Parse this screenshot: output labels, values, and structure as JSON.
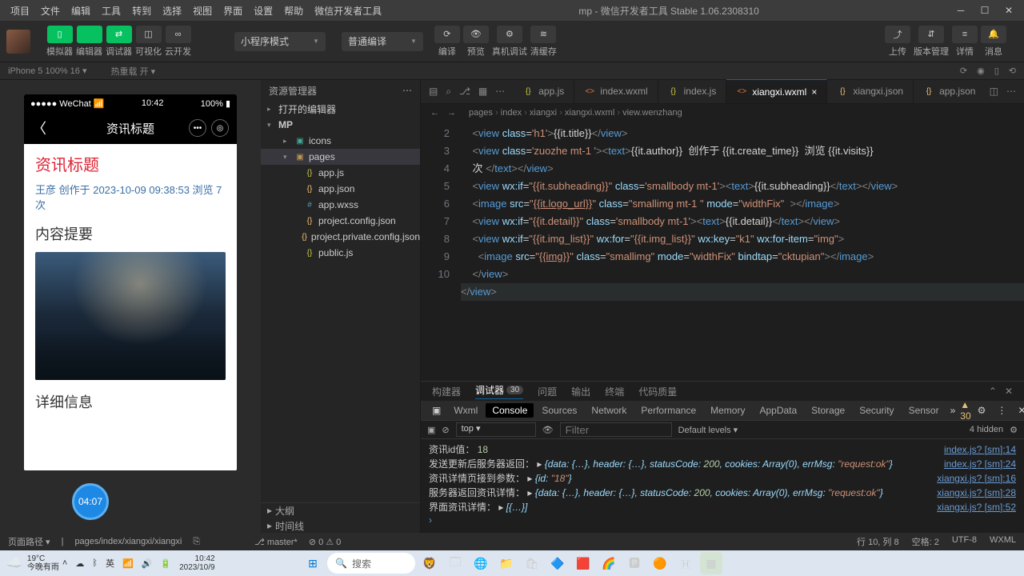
{
  "window": {
    "title": "mp - 微信开发者工具 Stable 1.06.2308310"
  },
  "menubar": [
    "项目",
    "文件",
    "编辑",
    "工具",
    "转到",
    "选择",
    "视图",
    "界面",
    "设置",
    "帮助",
    "微信开发者工具"
  ],
  "toolbar": {
    "modes": [
      {
        "icon": "▯",
        "label": "模拟器",
        "green": true
      },
      {
        "icon": "</>",
        "label": "编辑器",
        "green": true
      },
      {
        "icon": "⇄",
        "label": "调试器",
        "green": true
      },
      {
        "icon": "◫",
        "label": "可视化",
        "green": false
      },
      {
        "icon": "∞",
        "label": "云开发",
        "green": false
      }
    ],
    "dd1": "小程序模式",
    "dd2": "普通编译",
    "mid": [
      {
        "icon": "⟳",
        "label": "编译"
      },
      {
        "icon": "👁",
        "label": "预览"
      },
      {
        "icon": "⚙",
        "label": "真机调试"
      },
      {
        "icon": "≋",
        "label": "清缓存"
      }
    ],
    "right": [
      {
        "icon": "⤴",
        "label": "上传"
      },
      {
        "icon": "⇵",
        "label": "版本管理"
      },
      {
        "icon": "≡",
        "label": "详情"
      },
      {
        "icon": "🔔",
        "label": "消息"
      }
    ]
  },
  "devicebar": {
    "device": "iPhone 5 100% 16 ▾",
    "hot": "热重载 开 ▾"
  },
  "sim": {
    "carrier": "●●●●● WeChat",
    "signal": "📶",
    "time": "10:42",
    "battery": "100% ▮",
    "navTitle": "资讯标题",
    "h1": "资讯标题",
    "meta": "王彦 创作于 2023-10-09 09:38:53 浏览 7 次",
    "sub": "内容提要",
    "detail": "详细信息",
    "rec": "04:07"
  },
  "explorer": {
    "title": "资源管理器",
    "section1": "打开的编辑器",
    "root": "MP",
    "items": [
      {
        "pad": 28,
        "chev": "▸",
        "cls": "folder2",
        "icon": "▣",
        "name": "icons"
      },
      {
        "pad": 28,
        "chev": "▾",
        "cls": "folder",
        "icon": "▣",
        "name": "pages",
        "sel": true
      },
      {
        "pad": 40,
        "chev": "",
        "cls": "js",
        "icon": "{}",
        "name": "app.js"
      },
      {
        "pad": 40,
        "chev": "",
        "cls": "json",
        "icon": "{}",
        "name": "app.json"
      },
      {
        "pad": 40,
        "chev": "",
        "cls": "wxss",
        "icon": "#",
        "name": "app.wxss"
      },
      {
        "pad": 40,
        "chev": "",
        "cls": "json",
        "icon": "{}",
        "name": "project.config.json"
      },
      {
        "pad": 40,
        "chev": "",
        "cls": "json",
        "icon": "{}",
        "name": "project.private.config.json"
      },
      {
        "pad": 40,
        "chev": "",
        "cls": "js",
        "icon": "{}",
        "name": "public.js"
      }
    ],
    "outline": "大纲",
    "timeline": "时间线"
  },
  "tabs": [
    {
      "cls": "js",
      "icon": "{}",
      "name": "app.js"
    },
    {
      "cls": "wxml",
      "icon": "<>",
      "name": "index.wxml"
    },
    {
      "cls": "js",
      "icon": "{}",
      "name": "index.js"
    },
    {
      "cls": "wxml",
      "icon": "<>",
      "name": "xiangxi.wxml",
      "active": true,
      "close": "×"
    },
    {
      "cls": "json",
      "icon": "{}",
      "name": "xiangxi.json"
    },
    {
      "cls": "json",
      "icon": "{}",
      "name": "app.json"
    }
  ],
  "breadcrumb": [
    "pages",
    "index",
    "xiangxi",
    "xiangxi.wxml",
    "view.wenzhang"
  ],
  "code": [
    {
      "n": 2,
      "t": "    <span class='tok-punc'>&lt;</span><span class='tok-tag'>view</span> <span class='tok-attr'>class</span>=<span class='tok-str'>'h1'</span><span class='tok-punc'>&gt;</span><span class='tok-txt'>{{it.title}}</span><span class='tok-punc'>&lt;/</span><span class='tok-tag'>view</span><span class='tok-punc'>&gt;</span>"
    },
    {
      "n": 3,
      "t": "    <span class='tok-punc'>&lt;</span><span class='tok-tag'>view</span> <span class='tok-attr'>class</span>=<span class='tok-str'>'zuozhe mt-1 '</span><span class='tok-punc'>&gt;&lt;</span><span class='tok-tag'>text</span><span class='tok-punc'>&gt;</span><span class='tok-txt'>{{it.author}}  创作于 {{it.create_time}}  浏览 {{it.visits}} </span>"
    },
    {
      "n": "",
      "t": "    <span class='tok-txt'>次 </span><span class='tok-punc'>&lt;/</span><span class='tok-tag'>text</span><span class='tok-punc'>&gt;&lt;/</span><span class='tok-tag'>view</span><span class='tok-punc'>&gt;</span>"
    },
    {
      "n": 4,
      "t": "    <span class='tok-punc'>&lt;</span><span class='tok-tag'>view</span> <span class='tok-attr'>wx:if</span>=<span class='tok-str'>\"{{it.subheading}}\"</span> <span class='tok-attr'>class</span>=<span class='tok-str'>'smallbody mt-1'</span><span class='tok-punc'>&gt;&lt;</span><span class='tok-tag'>text</span><span class='tok-punc'>&gt;</span><span class='tok-txt'>{{it.subheading}}</span><span class='tok-punc'>&lt;/</span><span class='tok-tag'>text</span><span class='tok-punc'>&gt;&lt;/</span><span class='tok-tag'>view</span><span class='tok-punc'>&gt;</span>"
    },
    {
      "n": 5,
      "t": "    <span class='tok-punc'>&lt;</span><span class='tok-tag'>image</span> <span class='tok-attr'>src</span>=<span class='tok-str'>\"<u>{{it.logo_url}}</u>\"</span> <span class='tok-attr'>class</span>=<span class='tok-str'>\"smallimg mt-1 \"</span> <span class='tok-attr'>mode</span>=<span class='tok-str'>\"widthFix\"</span>  <span class='tok-punc'>&gt;&lt;/</span><span class='tok-tag'>image</span><span class='tok-punc'>&gt;</span>"
    },
    {
      "n": 6,
      "t": "    <span class='tok-punc'>&lt;</span><span class='tok-tag'>view</span> <span class='tok-attr'>wx:if</span>=<span class='tok-str'>\"{{it.detail}}\"</span> <span class='tok-attr'>class</span>=<span class='tok-str'>'smallbody mt-1'</span><span class='tok-punc'>&gt;&lt;</span><span class='tok-tag'>text</span><span class='tok-punc'>&gt;</span><span class='tok-txt'>{{it.detail}}</span><span class='tok-punc'>&lt;/</span><span class='tok-tag'>text</span><span class='tok-punc'>&gt;&lt;/</span><span class='tok-tag'>view</span><span class='tok-punc'>&gt;</span>"
    },
    {
      "n": 7,
      "t": "    <span class='tok-punc'>&lt;</span><span class='tok-tag'>view</span> <span class='tok-attr'>wx:if</span>=<span class='tok-str'>\"{{it.img_list}}\"</span> <span class='tok-attr'>wx:for</span>=<span class='tok-str'>\"{{it.img_list}}\"</span> <span class='tok-attr'>wx:key</span>=<span class='tok-str'>\"k1\"</span> <span class='tok-attr'>wx:for-item</span>=<span class='tok-str'>\"img\"</span><span class='tok-punc'>&gt;</span>"
    },
    {
      "n": 8,
      "t": "      <span class='tok-punc'>&lt;</span><span class='tok-tag'>image</span> <span class='tok-attr'>src</span>=<span class='tok-str'>\"<u>{{img}}</u>\"</span> <span class='tok-attr'>class</span>=<span class='tok-str'>\"smallimg\"</span> <span class='tok-attr'>mode</span>=<span class='tok-str'>\"widthFix\"</span> <span class='tok-attr'>bindtap</span>=<span class='tok-str'>\"cktupian\"</span><span class='tok-punc'>&gt;&lt;/</span><span class='tok-tag'>image</span><span class='tok-punc'>&gt;</span>"
    },
    {
      "n": 9,
      "t": "    <span class='tok-punc'>&lt;/</span><span class='tok-tag'>view</span><span class='tok-punc'>&gt;</span>"
    },
    {
      "n": 10,
      "t": "<span class='tok-punc'>&lt;/</span><span class='tok-tag'>view</span><span class='tok-punc'>&gt;</span>",
      "hl": true
    }
  ],
  "bp": {
    "tabs": [
      "构建器",
      "调试器",
      "问题",
      "输出",
      "终端",
      "代码质量"
    ],
    "active": 1,
    "badge": "30"
  },
  "devtabs": [
    "Wxml",
    "Console",
    "Sources",
    "Network",
    "Performance",
    "Memory",
    "AppData",
    "Storage",
    "Security",
    "Sensor"
  ],
  "devwarn": "30",
  "filter": {
    "top": "top",
    "ph": "Filter",
    "levels": "Default levels ▾",
    "hidden": "4 hidden"
  },
  "console": [
    {
      "l": "资讯id值：  <span class='c-num'>18</span>",
      "r": "index.js? [sm]:14"
    },
    {
      "l": "发送更新后服务器返回：  ▸ <span class='c-obj'>{data: {…}, header: {…}, statusCode: <span class='c-num'>200</span>, cookies: Array(0), errMsg: <span class='c-str'>\"request:ok\"</span>}</span>",
      "r": "index.js? [sm]:24"
    },
    {
      "l": "资讯详情页接到参数：  ▸ <span class='c-obj'>{id: <span class='c-str'>\"18\"</span>}</span>",
      "r": "xiangxi.js? [sm]:16"
    },
    {
      "l": "服务器返回资讯详情：  ▸ <span class='c-obj'>{data: {…}, header: {…}, statusCode: <span class='c-num'>200</span>, cookies: Array(0), errMsg: <span class='c-str'>\"request:ok\"</span>}</span>",
      "r": "xiangxi.js? [sm]:28"
    },
    {
      "l": "界面资讯详情：  ▸ <span class='c-obj'>[{…}]</span>",
      "r": "xiangxi.js? [sm]:52"
    }
  ],
  "status": {
    "route": "页面路径 ▾",
    "path": "pages/index/xiangxi/xiangxi",
    "branch": "master*",
    "err": "⊘ 0 ⚠ 0",
    "pos": "行 10, 列 8",
    "sp": "空格: 2",
    "enc": "UTF-8",
    "lang": "WXML"
  },
  "taskbar": {
    "temp": "19°C",
    "weather": "今晚有雨",
    "search": "搜索",
    "time": "10:42",
    "date": "2023/10/9"
  }
}
